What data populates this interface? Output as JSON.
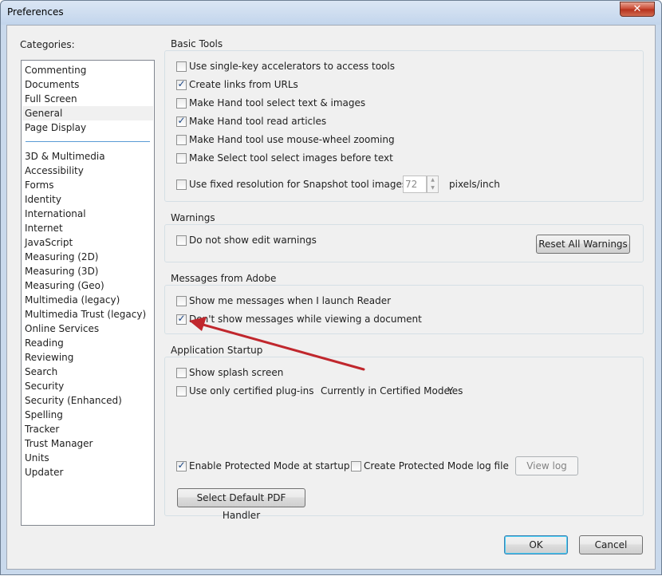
{
  "window": {
    "title": "Preferences",
    "close_glyph": "✕"
  },
  "categories": {
    "label": "Categories:",
    "items": [
      "Commenting",
      "Documents",
      "Full Screen",
      "General",
      "Page Display",
      "3D & Multimedia",
      "Accessibility",
      "Forms",
      "Identity",
      "International",
      "Internet",
      "JavaScript",
      "Measuring (2D)",
      "Measuring (3D)",
      "Measuring (Geo)",
      "Multimedia (legacy)",
      "Multimedia Trust (legacy)",
      "Online Services",
      "Reading",
      "Reviewing",
      "Search",
      "Security",
      "Security (Enhanced)",
      "Spelling",
      "Tracker",
      "Trust Manager",
      "Units",
      "Updater"
    ],
    "selected": "General"
  },
  "basic_tools": {
    "title": "Basic Tools",
    "options": [
      {
        "label": "Use single-key accelerators to access tools",
        "checked": false
      },
      {
        "label": "Create links from URLs",
        "checked": true
      },
      {
        "label": "Make Hand tool select text & images",
        "checked": false
      },
      {
        "label": "Make Hand tool read articles",
        "checked": true
      },
      {
        "label": "Make Hand tool use mouse-wheel zooming",
        "checked": false
      },
      {
        "label": "Make Select tool select images before text",
        "checked": false
      }
    ],
    "snapshot": {
      "label": "Use fixed resolution for Snapshot tool images:",
      "checked": false,
      "value": "72",
      "unit": "pixels/inch"
    }
  },
  "warnings": {
    "title": "Warnings",
    "option": {
      "label": "Do not show edit warnings",
      "checked": false
    },
    "reset_button": "Reset All Warnings"
  },
  "messages": {
    "title": "Messages from Adobe",
    "options": [
      {
        "label": "Show me messages when I launch Reader",
        "checked": false
      },
      {
        "label": "Don't show messages while viewing a document",
        "checked": true
      }
    ]
  },
  "startup": {
    "title": "Application Startup",
    "splash": {
      "label": "Show splash screen",
      "checked": false
    },
    "certified": {
      "label": "Use only certified plug-ins",
      "checked": false
    },
    "certified_mode_label": "Currently in Certified Mode:",
    "certified_mode_value": "Yes",
    "protected_mode": {
      "label": "Enable Protected Mode at startup",
      "checked": true
    },
    "protected_log": {
      "label": "Create Protected Mode log file",
      "checked": false
    },
    "view_log_button": "View log",
    "default_handler_button": "Select Default PDF Handler"
  },
  "footer": {
    "ok": "OK",
    "cancel": "Cancel"
  },
  "colors": {
    "annotation_arrow": "#c0272d",
    "selection": "#5a9bd5"
  },
  "check_glyph": "✓"
}
